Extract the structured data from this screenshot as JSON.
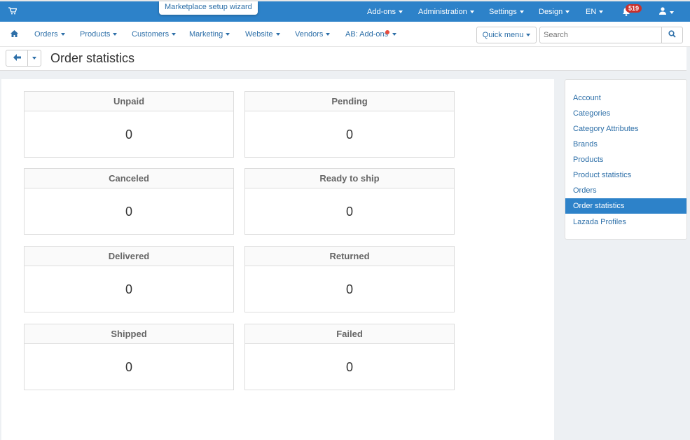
{
  "topbar": {
    "wizard_label": "Marketplace setup wizard",
    "menus": [
      "Add-ons",
      "Administration",
      "Settings",
      "Design",
      "EN"
    ],
    "notification_count": "519"
  },
  "nav": {
    "items": [
      "Orders",
      "Products",
      "Customers",
      "Marketing",
      "Website",
      "Vendors",
      "AB: Add-ons"
    ],
    "quick_menu": "Quick menu",
    "search_placeholder": "Search"
  },
  "page": {
    "title": "Order statistics"
  },
  "cards": [
    {
      "label": "Unpaid",
      "value": "0"
    },
    {
      "label": "Pending",
      "value": "0"
    },
    {
      "label": "Canceled",
      "value": "0"
    },
    {
      "label": "Ready to ship",
      "value": "0"
    },
    {
      "label": "Delivered",
      "value": "0"
    },
    {
      "label": "Returned",
      "value": "0"
    },
    {
      "label": "Shipped",
      "value": "0"
    },
    {
      "label": "Failed",
      "value": "0"
    }
  ],
  "sidebar": {
    "items": [
      {
        "label": "Account"
      },
      {
        "label": "Categories"
      },
      {
        "label": "Category Attributes"
      },
      {
        "label": "Brands"
      },
      {
        "label": "Products"
      },
      {
        "label": "Product statistics"
      },
      {
        "label": "Orders"
      },
      {
        "label": "Order statistics",
        "active": true
      },
      {
        "label": "Lazada Profiles"
      }
    ]
  },
  "colors": {
    "accent": "#2d82c9",
    "link": "#2d6fa8"
  }
}
